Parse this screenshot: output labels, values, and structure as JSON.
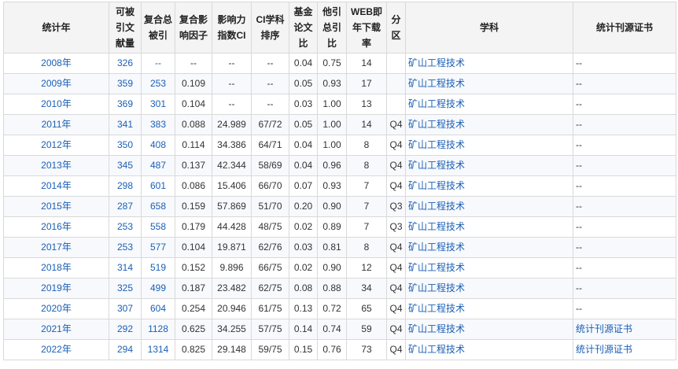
{
  "headers": [
    "统计年",
    "可被\n引文\n献量",
    "复合总\n被引",
    "复合影\n响因子",
    "影响力\n指数CI",
    "CI学科\n排序",
    "基金\n论文\n比",
    "他引\n总引\n比",
    "WEB即\n年下载\n率",
    "分\n区",
    "学科",
    "统计刊源证书"
  ],
  "rows": [
    {
      "year": "2008年",
      "citable": "326",
      "total_cited": "--",
      "impact": "--",
      "ci": "--",
      "rank": "--",
      "fund": "0.04",
      "other": "0.75",
      "web": "14",
      "zone": "",
      "subject": "矿山工程技术",
      "cert": "--"
    },
    {
      "year": "2009年",
      "citable": "359",
      "total_cited": "253",
      "impact": "0.109",
      "ci": "--",
      "rank": "--",
      "fund": "0.05",
      "other": "0.93",
      "web": "17",
      "zone": "",
      "subject": "矿山工程技术",
      "cert": "--"
    },
    {
      "year": "2010年",
      "citable": "369",
      "total_cited": "301",
      "impact": "0.104",
      "ci": "--",
      "rank": "--",
      "fund": "0.03",
      "other": "1.00",
      "web": "13",
      "zone": "",
      "subject": "矿山工程技术",
      "cert": "--"
    },
    {
      "year": "2011年",
      "citable": "341",
      "total_cited": "383",
      "impact": "0.088",
      "ci": "24.989",
      "rank": "67/72",
      "fund": "0.05",
      "other": "1.00",
      "web": "14",
      "zone": "Q4",
      "subject": "矿山工程技术",
      "cert": "--"
    },
    {
      "year": "2012年",
      "citable": "350",
      "total_cited": "408",
      "impact": "0.114",
      "ci": "34.386",
      "rank": "64/71",
      "fund": "0.04",
      "other": "1.00",
      "web": "8",
      "zone": "Q4",
      "subject": "矿山工程技术",
      "cert": "--"
    },
    {
      "year": "2013年",
      "citable": "345",
      "total_cited": "487",
      "impact": "0.137",
      "ci": "42.344",
      "rank": "58/69",
      "fund": "0.04",
      "other": "0.96",
      "web": "8",
      "zone": "Q4",
      "subject": "矿山工程技术",
      "cert": "--"
    },
    {
      "year": "2014年",
      "citable": "298",
      "total_cited": "601",
      "impact": "0.086",
      "ci": "15.406",
      "rank": "66/70",
      "fund": "0.07",
      "other": "0.93",
      "web": "7",
      "zone": "Q4",
      "subject": "矿山工程技术",
      "cert": "--"
    },
    {
      "year": "2015年",
      "citable": "287",
      "total_cited": "658",
      "impact": "0.159",
      "ci": "57.869",
      "rank": "51/70",
      "fund": "0.20",
      "other": "0.90",
      "web": "7",
      "zone": "Q3",
      "subject": "矿山工程技术",
      "cert": "--"
    },
    {
      "year": "2016年",
      "citable": "253",
      "total_cited": "558",
      "impact": "0.179",
      "ci": "44.428",
      "rank": "48/75",
      "fund": "0.02",
      "other": "0.89",
      "web": "7",
      "zone": "Q3",
      "subject": "矿山工程技术",
      "cert": "--"
    },
    {
      "year": "2017年",
      "citable": "253",
      "total_cited": "577",
      "impact": "0.104",
      "ci": "19.871",
      "rank": "62/76",
      "fund": "0.03",
      "other": "0.81",
      "web": "8",
      "zone": "Q4",
      "subject": "矿山工程技术",
      "cert": "--"
    },
    {
      "year": "2018年",
      "citable": "314",
      "total_cited": "519",
      "impact": "0.152",
      "ci": "9.896",
      "rank": "66/75",
      "fund": "0.02",
      "other": "0.90",
      "web": "12",
      "zone": "Q4",
      "subject": "矿山工程技术",
      "cert": "--"
    },
    {
      "year": "2019年",
      "citable": "325",
      "total_cited": "499",
      "impact": "0.187",
      "ci": "23.482",
      "rank": "62/75",
      "fund": "0.08",
      "other": "0.88",
      "web": "34",
      "zone": "Q4",
      "subject": "矿山工程技术",
      "cert": "--"
    },
    {
      "year": "2020年",
      "citable": "307",
      "total_cited": "604",
      "impact": "0.254",
      "ci": "20.946",
      "rank": "61/75",
      "fund": "0.13",
      "other": "0.72",
      "web": "65",
      "zone": "Q4",
      "subject": "矿山工程技术",
      "cert": "--"
    },
    {
      "year": "2021年",
      "citable": "292",
      "total_cited": "1128",
      "impact": "0.625",
      "ci": "34.255",
      "rank": "57/75",
      "fund": "0.14",
      "other": "0.74",
      "web": "59",
      "zone": "Q4",
      "subject": "矿山工程技术",
      "cert": "统计刊源证书"
    },
    {
      "year": "2022年",
      "citable": "294",
      "total_cited": "1314",
      "impact": "0.825",
      "ci": "29.148",
      "rank": "59/75",
      "fund": "0.15",
      "other": "0.76",
      "web": "73",
      "zone": "Q4",
      "subject": "矿山工程技术",
      "cert": "统计刊源证书"
    }
  ]
}
